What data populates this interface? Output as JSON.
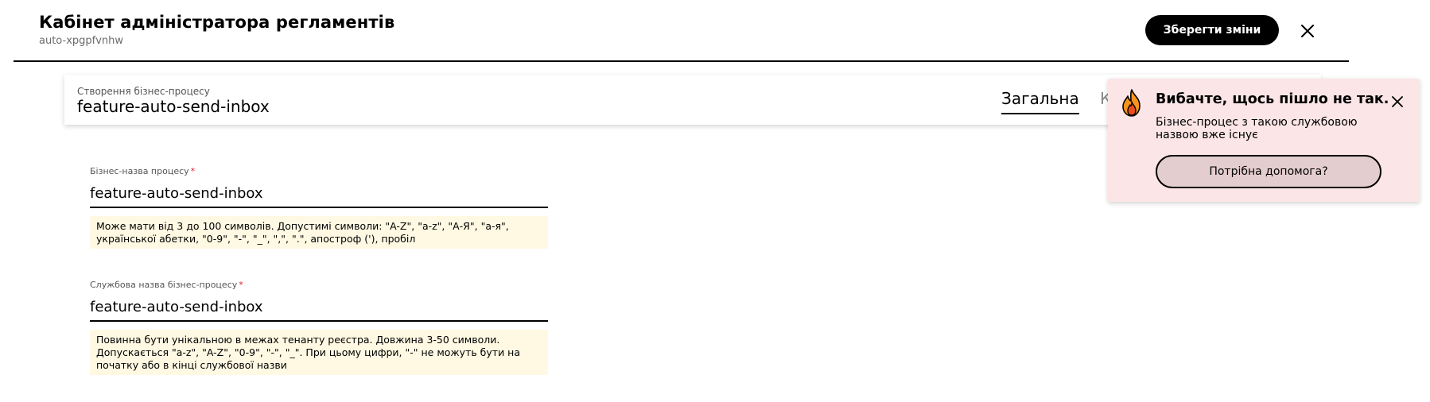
{
  "header": {
    "title": "Кабінет адміністратора регламентів",
    "subtitle": "auto-xpgpfvnhw",
    "save_label": "Зберегти зміни",
    "close_icon": "close-icon"
  },
  "process": {
    "caption": "Створення бізнес-процесу",
    "name": "feature-auto-send-inbox",
    "tabs": [
      {
        "label": "Загальна",
        "active": true
      },
      {
        "label": "К",
        "active": false
      }
    ]
  },
  "form": {
    "business_name": {
      "label": "Бізнес-назва процесу",
      "required_mark": "*",
      "value": "feature-auto-send-inbox",
      "hint": "Може мати від 3 до 100 символів. Допустимі символи: \"A-Z\", \"a-z\", \"А-Я\", \"а-я\", української абетки, \"0-9\", \"-\", \"_\", \",\", \".\", апостроф ('), пробіл"
    },
    "service_name": {
      "label": "Службова назва бізнес-процесу",
      "required_mark": "*",
      "value": "feature-auto-send-inbox",
      "hint": "Повинна бути унікальною в межах тенанту реєстра. Довжина 3-50 символи. Допускається \"a-z\", \"A-Z\", \"0-9\", \"-\", \"_\". При цьому цифри, \"-\" не можуть бути на початку або в кінці службової назви"
    }
  },
  "toast": {
    "icon": "fire-icon",
    "title": "Вибачте, щось пішло не так.",
    "message": "Бізнес-процес з такою службовою назвою вже існує",
    "help_label": "Потрібна допомога?",
    "close_icon": "close-icon"
  },
  "colors": {
    "accent": "#000000",
    "hint_bg": "#fff9e3",
    "toast_bg": "#fbe5e6",
    "help_btn_bg": "#e4cdcf",
    "required": "#e0202b"
  }
}
